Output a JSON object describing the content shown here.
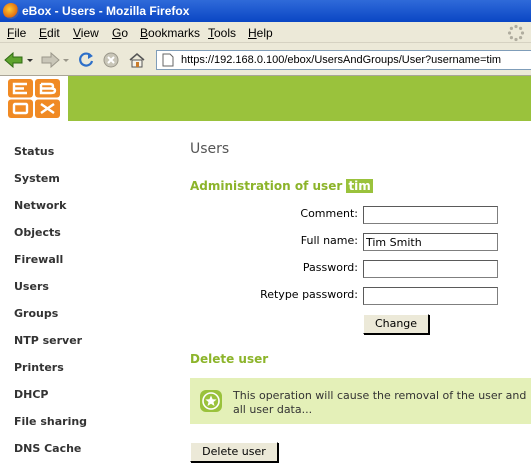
{
  "window": {
    "title": "eBox - Users - Mozilla Firefox"
  },
  "menu": {
    "items": [
      {
        "label": "File"
      },
      {
        "label": "Edit"
      },
      {
        "label": "View"
      },
      {
        "label": "Go"
      },
      {
        "label": "Bookmarks"
      },
      {
        "label": "Tools"
      },
      {
        "label": "Help"
      }
    ]
  },
  "toolbar": {
    "url": "https://192.168.0.100/ebox/UsersAndGroups/User?username=tim"
  },
  "logo": {
    "letters": [
      "E",
      "B",
      "O",
      "X"
    ]
  },
  "sidebar": {
    "items": [
      {
        "label": "Status"
      },
      {
        "label": "System"
      },
      {
        "label": "Network"
      },
      {
        "label": "Objects"
      },
      {
        "label": "Firewall"
      },
      {
        "label": "Users"
      },
      {
        "label": "Groups"
      },
      {
        "label": "NTP server"
      },
      {
        "label": "Printers"
      },
      {
        "label": "DHCP"
      },
      {
        "label": "File sharing"
      },
      {
        "label": "DNS Cache"
      }
    ]
  },
  "main": {
    "title": "Users",
    "admin_heading": "Administration of user",
    "username": "tim",
    "form": {
      "comment_label": "Comment:",
      "comment_value": "",
      "fullname_label": "Full name:",
      "fullname_value": "Tim Smith",
      "password_label": "Password:",
      "password_value": "",
      "retype_label": "Retype password:",
      "retype_value": "",
      "change_button": "Change"
    },
    "delete": {
      "heading": "Delete user",
      "warning": "This operation will cause the removal of the user and all user data...",
      "button": "Delete user"
    }
  },
  "colors": {
    "accent": "#9ac23c",
    "heading": "#8cb42a",
    "warning_bg": "#e4f0b8"
  }
}
